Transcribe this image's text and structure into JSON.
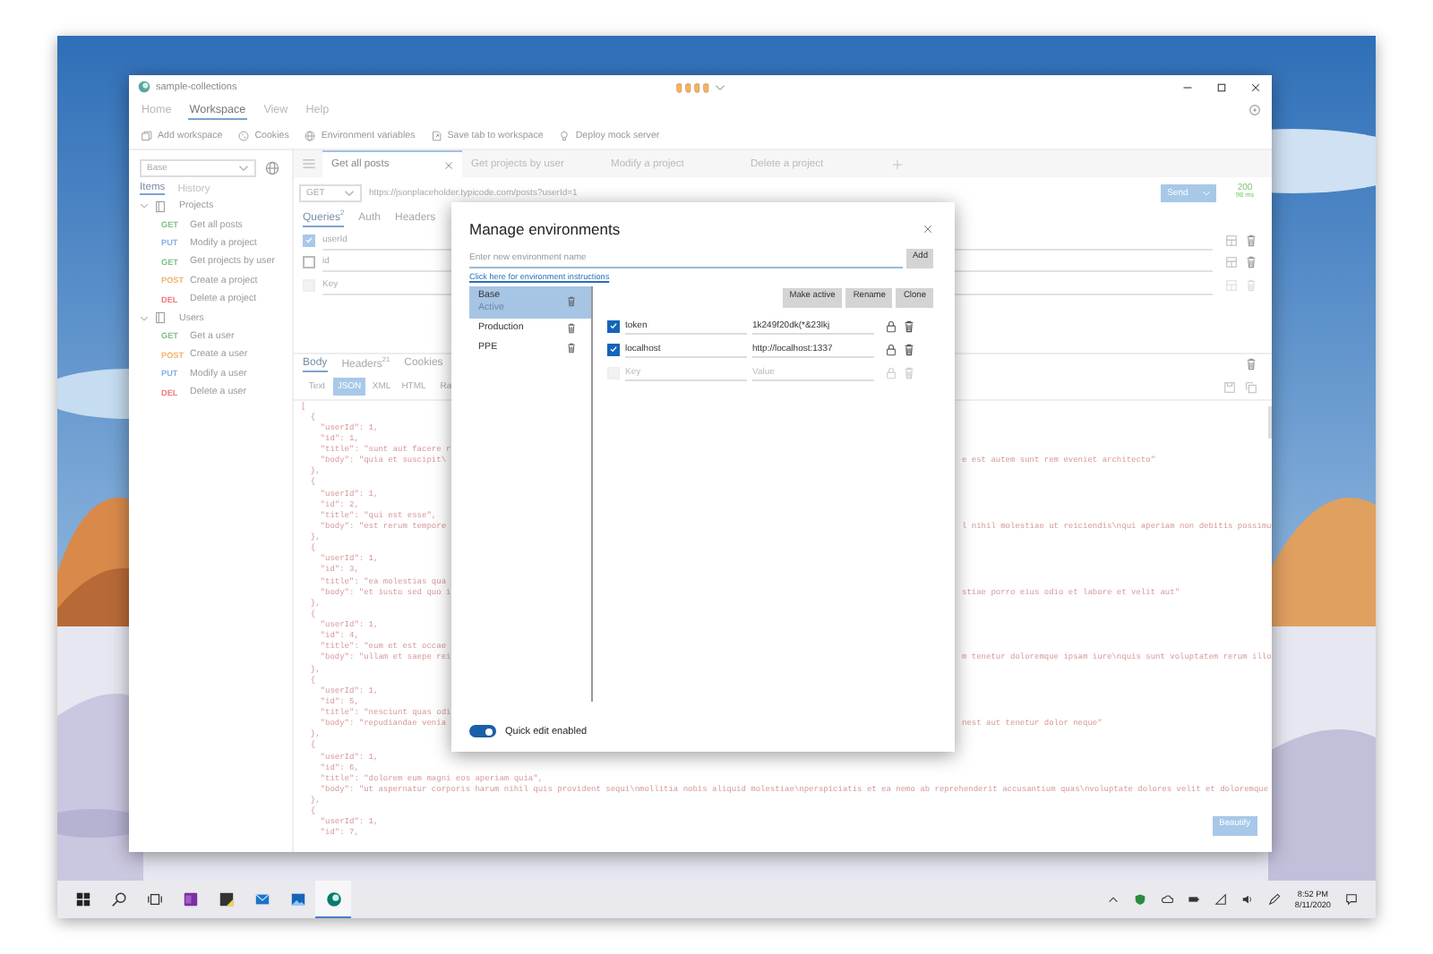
{
  "window": {
    "title": "sample-collections"
  },
  "menu": [
    {
      "label": "Home",
      "selected": false
    },
    {
      "label": "Workspace",
      "selected": true
    },
    {
      "label": "View",
      "selected": false
    },
    {
      "label": "Help",
      "selected": false
    }
  ],
  "toolbar": [
    {
      "kind": "stack",
      "label": "Add workspace"
    },
    {
      "kind": "cookie",
      "label": "Cookies"
    },
    {
      "kind": "globe",
      "label": "Environment variables"
    },
    {
      "kind": "export",
      "label": "Save tab to workspace"
    },
    {
      "kind": "deploy",
      "label": "Deploy mock server"
    }
  ],
  "sidebar": {
    "environment": "Base",
    "tabs": [
      {
        "label": "Items",
        "selected": true
      },
      {
        "label": "History",
        "selected": false
      }
    ],
    "tree": [
      {
        "label": "Projects",
        "expanded": true,
        "children": [
          {
            "method": "GET",
            "color": "#7cc08a",
            "label": "Get all posts"
          },
          {
            "method": "PUT",
            "color": "#86aee0",
            "label": "Modify a project"
          },
          {
            "method": "GET",
            "color": "#7cc08a",
            "label": "Get projects by user"
          },
          {
            "method": "POST",
            "color": "#f3b36b",
            "label": "Create a project"
          },
          {
            "method": "DEL",
            "color": "#ee7a7a",
            "label": "Delete a project"
          }
        ]
      },
      {
        "label": "Users",
        "expanded": true,
        "children": [
          {
            "method": "GET",
            "color": "#7cc08a",
            "label": "Get a user"
          },
          {
            "method": "POST",
            "color": "#f3b36b",
            "label": "Create a user"
          },
          {
            "method": "PUT",
            "color": "#86aee0",
            "label": "Modify a user"
          },
          {
            "method": "DEL",
            "color": "#ee7a7a",
            "label": "Delete a user"
          }
        ]
      }
    ]
  },
  "request_tabs": [
    {
      "label": "Get all posts",
      "selected": true
    },
    {
      "label": "Get projects by user",
      "selected": false
    },
    {
      "label": "Modify a project",
      "selected": false
    },
    {
      "label": "Delete a project",
      "selected": false
    }
  ],
  "request": {
    "method": "GET",
    "url": "https://jsonplaceholder.typicode.com/posts?userId=1",
    "send": "Send",
    "status": "200",
    "time": "98 ms"
  },
  "request_sections": [
    {
      "label": "Queries$^{2}$",
      "selected": true
    },
    {
      "label": "Auth",
      "selected": false
    },
    {
      "label": "Headers",
      "selected": false
    }
  ],
  "params": [
    {
      "key": "userId",
      "checked": true,
      "disabled": false
    },
    {
      "key": "id",
      "checked": false,
      "disabled": false
    },
    {
      "placeholder": "Key",
      "checked": false,
      "disabled": true
    }
  ],
  "response_sections": [
    {
      "label": "Body",
      "selected": true
    },
    {
      "label": "Headers$^{21}$",
      "selected": false
    },
    {
      "label": "Cookies",
      "selected": false
    }
  ],
  "formats": [
    {
      "label": "Text",
      "selected": false
    },
    {
      "label": "JSON",
      "selected": true
    },
    {
      "label": "XML",
      "selected": false
    },
    {
      "label": "HTML",
      "selected": false
    },
    {
      "label": "Ra",
      "selected": false
    }
  ],
  "response_lines": [
    {
      "left": "["
    },
    {
      "left": "  {"
    },
    {
      "left": "    \"userId\": 1,"
    },
    {
      "left": "    \"id\": 1,"
    },
    {
      "left": "    \"title\": \"sunt aut facere r"
    },
    {
      "left": "    \"body\": \"quia et suscipit\\",
      "right": "e est autem sunt rem eveniet architecto\""
    },
    {
      "left": "  },"
    },
    {
      "left": "  {"
    },
    {
      "left": "    \"userId\": 1,"
    },
    {
      "left": "    \"id\": 2,"
    },
    {
      "left": "    \"title\": \"qui est esse\","
    },
    {
      "left": "    \"body\": \"est rerum tempore",
      "right": "l nihil molestiae ut reiciendis\\nqui aperiam non debitis possimu"
    },
    {
      "left": "  },"
    },
    {
      "left": "  {"
    },
    {
      "left": "    \"userId\": 1,"
    },
    {
      "left": "    \"id\": 3,"
    },
    {
      "left": "    \"title\": \"ea molestias qua"
    },
    {
      "left": "    \"body\": \"et iusto sed quo i",
      "right": "stiae porro eius odio et labore et velit aut\""
    },
    {
      "left": "  },"
    },
    {
      "left": "  {"
    },
    {
      "left": "    \"userId\": 1,"
    },
    {
      "left": "    \"id\": 4,"
    },
    {
      "left": "    \"title\": \"eum et est occae"
    },
    {
      "left": "    \"body\": \"ullam et saepe rei",
      "right": "m tenetur doloremque ipsam iure\\nquis sunt voluptatem rerum illo"
    },
    {
      "left": "  },"
    },
    {
      "left": "  {"
    },
    {
      "left": "    \"userId\": 1,"
    },
    {
      "left": "    \"id\": 5,"
    },
    {
      "left": "    \"title\": \"nesciunt quas odi"
    },
    {
      "left": "    \"body\": \"repudiandae venia",
      "right": "nest aut tenetur dolor neque\""
    },
    {
      "left": "  },"
    },
    {
      "left": "  {"
    },
    {
      "left": "    \"userId\": 1,"
    },
    {
      "left": "    \"id\": 6,"
    },
    {
      "left": "    \"title\": \"dolorem eum magni eos aperiam quia\","
    },
    {
      "left": "    \"body\": \"ut aspernatur corporis harum nihil quis provident sequi\\nmollitia nobis aliquid molestiae\\nperspiciatis et ea nemo ab reprehenderit accusantium quas\\nvoluptate dolores velit et doloremque"
    },
    {
      "left": "  },"
    },
    {
      "left": "  {"
    },
    {
      "left": "    \"userId\": 1,"
    },
    {
      "left": "    \"id\": 7,"
    }
  ],
  "beautify": "Beautify",
  "modal": {
    "title": "Manage environments",
    "name_placeholder": "Enter new environment name",
    "add": "Add",
    "link": "Click here for environment instructions",
    "environments": [
      {
        "name": "Base",
        "status": "Active",
        "selected": true
      },
      {
        "name": "Production",
        "selected": false
      },
      {
        "name": "PPE",
        "selected": false
      }
    ],
    "actions": [
      "Make active",
      "Rename",
      "Clone"
    ],
    "variables": [
      {
        "key": "token",
        "value": "1k249f20dk(*&23lkj",
        "checked": true,
        "disabled": false
      },
      {
        "key": "localhost",
        "value": "http://localhost:1337",
        "checked": true,
        "disabled": false
      },
      {
        "key_placeholder": "Key",
        "value_placeholder": "Value",
        "checked": false,
        "disabled": true
      }
    ],
    "quick_edit": {
      "label": "Quick edit enabled",
      "on": true
    }
  },
  "taskbar": {
    "apps": [
      {
        "kind": "start",
        "selected": false
      },
      {
        "kind": "search",
        "selected": false
      },
      {
        "kind": "tasks",
        "selected": false
      },
      {
        "kind": "notebook",
        "selected": false
      },
      {
        "kind": "notes",
        "selected": false
      },
      {
        "kind": "mail",
        "selected": false
      },
      {
        "kind": "photos",
        "selected": false
      },
      {
        "kind": "app",
        "selected": true
      }
    ],
    "time": "8:52 PM",
    "date": "8/11/2020"
  }
}
